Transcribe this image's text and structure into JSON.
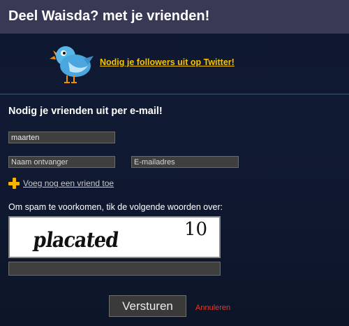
{
  "header": {
    "title": "Deel Waisda? met je vrienden!"
  },
  "twitter": {
    "link_label": "Nodig je followers uit op Twitter!",
    "icon": "twitter-bird-icon"
  },
  "email_section": {
    "title": "Nodig je vrienden uit per e-mail!",
    "sender_value": "maarten",
    "recipient_name_placeholder": "Naam ontvanger",
    "recipient_email_placeholder": "E-mailadres",
    "add_friend_label": "Voeg nog een vriend toe"
  },
  "captcha": {
    "instruction": "Om spam te voorkomen, tik de volgende woorden over:",
    "word": "placated",
    "number": "10",
    "input_value": ""
  },
  "actions": {
    "submit_label": "Versturen",
    "cancel_label": "Annuleren"
  },
  "colors": {
    "header_bg": "#383a55",
    "link_yellow": "#f5c400",
    "cancel_red": "#e03b2f"
  }
}
